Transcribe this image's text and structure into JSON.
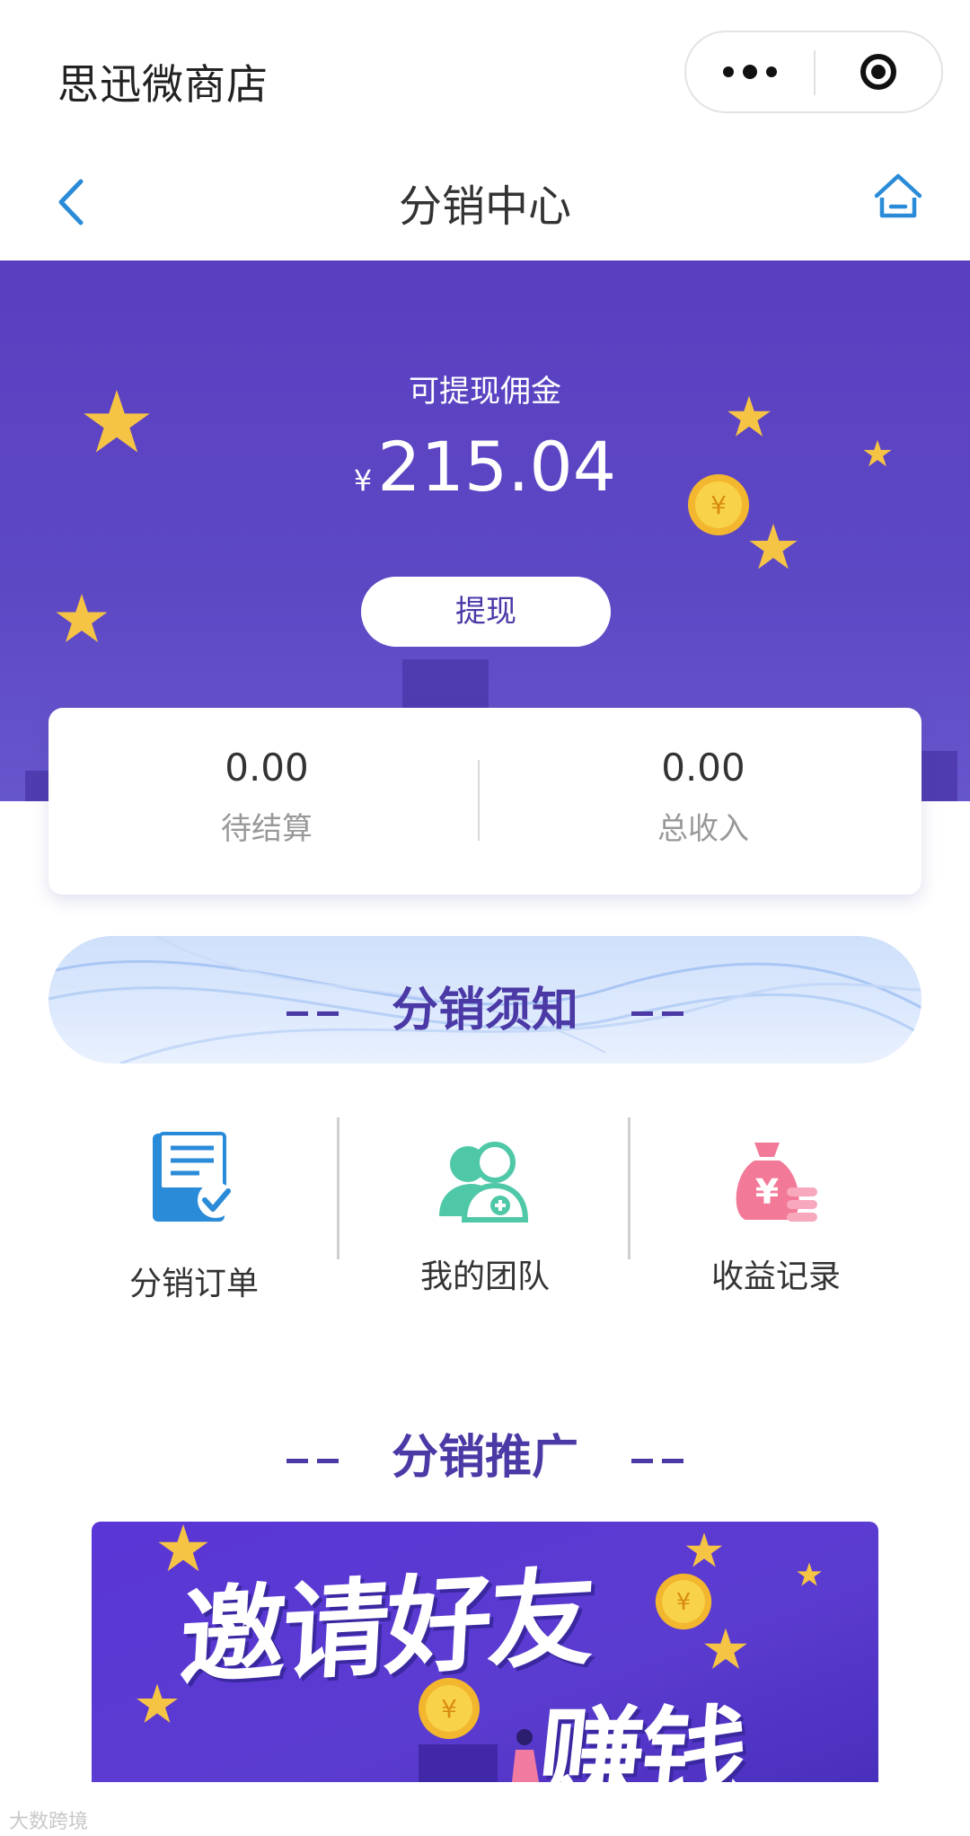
{
  "app": {
    "title": "思迅微商店"
  },
  "nav": {
    "title": "分销中心"
  },
  "hero": {
    "label": "可提现佣金",
    "currency": "¥",
    "amount": "215.04",
    "withdraw_label": "提现"
  },
  "stats": [
    {
      "value": "0.00",
      "label": "待结算"
    },
    {
      "value": "0.00",
      "label": "总收入"
    }
  ],
  "notice": {
    "title": "分销须知"
  },
  "menu": [
    {
      "label": "分销订单",
      "icon": "order-check-icon"
    },
    {
      "label": "我的团队",
      "icon": "team-add-icon"
    },
    {
      "label": "收益记录",
      "icon": "money-bag-icon"
    }
  ],
  "promo": {
    "title": "分销推广",
    "banner_line1": "邀请好友",
    "banner_line2": "赚钱",
    "coin_symbol": "¥"
  },
  "watermark": "大数跨境",
  "colors": {
    "brand_purple": "#5a3fc0",
    "accent_blue": "#2a8bd8",
    "title_purple": "#4b3aa6"
  }
}
